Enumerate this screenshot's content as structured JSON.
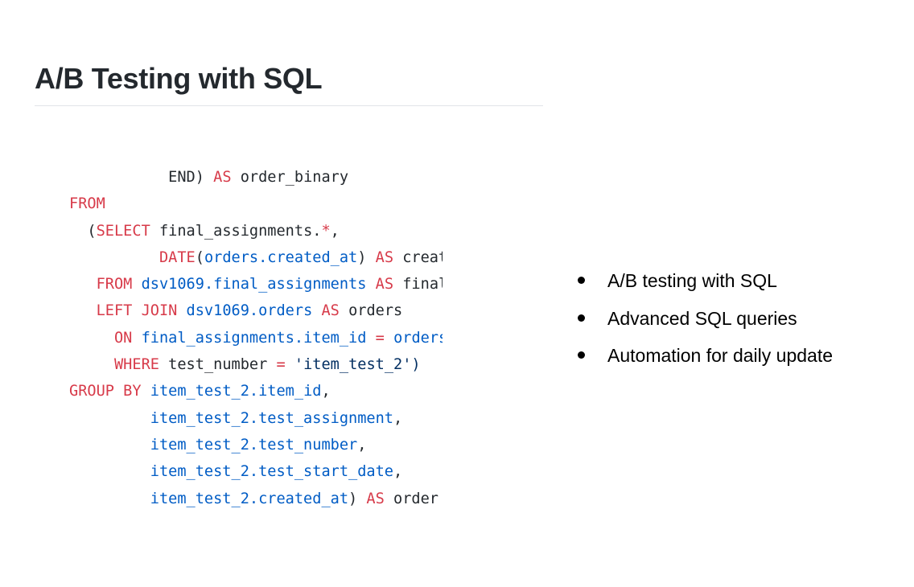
{
  "title": "A/B Testing with SQL",
  "code_lines": [
    [
      {
        "t": "           END) ",
        "c": "id"
      },
      {
        "t": "AS",
        "c": "kw"
      },
      {
        "t": " order_binary",
        "c": "id"
      }
    ],
    [
      {
        "t": "FROM",
        "c": "kw"
      }
    ],
    [
      {
        "t": "  (",
        "c": "id"
      },
      {
        "t": "SELECT",
        "c": "kw"
      },
      {
        "t": " final_assignments.",
        "c": "id"
      },
      {
        "t": "*",
        "c": "kw"
      },
      {
        "t": ",",
        "c": "id"
      }
    ],
    [
      {
        "t": "          ",
        "c": "id"
      },
      {
        "t": "DATE",
        "c": "kw"
      },
      {
        "t": "(",
        "c": "id"
      },
      {
        "t": "orders.created_at",
        "c": "ref"
      },
      {
        "t": ") ",
        "c": "id"
      },
      {
        "t": "AS",
        "c": "kw"
      },
      {
        "t": " created_date",
        "c": "id"
      }
    ],
    [
      {
        "t": "   ",
        "c": "id"
      },
      {
        "t": "FROM",
        "c": "kw"
      },
      {
        "t": " ",
        "c": "id"
      },
      {
        "t": "dsv1069.final_assignments",
        "c": "ref"
      },
      {
        "t": " ",
        "c": "id"
      },
      {
        "t": "AS",
        "c": "kw"
      },
      {
        "t": " final_assignments",
        "c": "id"
      }
    ],
    [
      {
        "t": "   ",
        "c": "id"
      },
      {
        "t": "LEFT JOIN",
        "c": "kw"
      },
      {
        "t": " ",
        "c": "id"
      },
      {
        "t": "dsv1069.orders",
        "c": "ref"
      },
      {
        "t": " ",
        "c": "id"
      },
      {
        "t": "AS",
        "c": "kw"
      },
      {
        "t": " orders",
        "c": "id"
      }
    ],
    [
      {
        "t": "     ",
        "c": "id"
      },
      {
        "t": "ON",
        "c": "kw"
      },
      {
        "t": " ",
        "c": "id"
      },
      {
        "t": "final_assignments.item_id",
        "c": "ref"
      },
      {
        "t": " ",
        "c": "id"
      },
      {
        "t": "=",
        "c": "kw"
      },
      {
        "t": " ",
        "c": "id"
      },
      {
        "t": "orders.item_id",
        "c": "ref"
      }
    ],
    [
      {
        "t": "     ",
        "c": "id"
      },
      {
        "t": "WHERE",
        "c": "kw"
      },
      {
        "t": " test_number ",
        "c": "id"
      },
      {
        "t": "=",
        "c": "kw"
      },
      {
        "t": " ",
        "c": "id"
      },
      {
        "t": "'item_test_2')",
        "c": "ref2"
      }
    ],
    [
      {
        "t": "GROUP BY",
        "c": "kw"
      },
      {
        "t": " ",
        "c": "id"
      },
      {
        "t": "item_test_2.item_id",
        "c": "ref"
      },
      {
        "t": ",",
        "c": "id"
      }
    ],
    [
      {
        "t": "         ",
        "c": "id"
      },
      {
        "t": "item_test_2.test_assignment",
        "c": "ref"
      },
      {
        "t": ",",
        "c": "id"
      }
    ],
    [
      {
        "t": "         ",
        "c": "id"
      },
      {
        "t": "item_test_2.test_number",
        "c": "ref"
      },
      {
        "t": ",",
        "c": "id"
      }
    ],
    [
      {
        "t": "         ",
        "c": "id"
      },
      {
        "t": "item_test_2.test_start_date",
        "c": "ref"
      },
      {
        "t": ",",
        "c": "id"
      }
    ],
    [
      {
        "t": "         ",
        "c": "id"
      },
      {
        "t": "item_test_2.created_at",
        "c": "ref"
      },
      {
        "t": ") ",
        "c": "id"
      },
      {
        "t": "AS",
        "c": "kw"
      },
      {
        "t": " order",
        "c": "id"
      }
    ]
  ],
  "bullets": [
    "A/B testing with SQL",
    "Advanced SQL queries",
    "Automation for daily update"
  ]
}
